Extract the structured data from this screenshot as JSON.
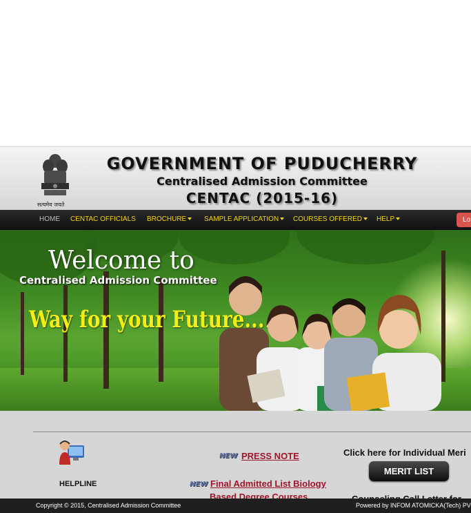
{
  "header": {
    "emblem_caption": "सत्यमेव जयते",
    "title_line1": "GOVERNMENT OF PUDUCHERRY",
    "title_line2": "Centralised Admission Committee",
    "title_line3": "CENTAC (2015-16)"
  },
  "nav": {
    "items": [
      {
        "label": "HOME"
      },
      {
        "label": "CENTAC OFFICIALS"
      },
      {
        "label": "BROCHURE"
      },
      {
        "label": "SAMPLE APPLICATION"
      },
      {
        "label": "COURSES OFFERED"
      },
      {
        "label": "HELP"
      }
    ],
    "login_label": "Lo"
  },
  "banner": {
    "welcome": "Welcome to",
    "subtitle": "Centralised Admission Committee",
    "tagline": "Way for your Future...."
  },
  "content": {
    "helpline_label": "HELPLINE",
    "new_badge": "NEW",
    "news": [
      {
        "label": "PRESS NOTE"
      },
      {
        "label": "Final Admitted List Biology"
      },
      {
        "label": "Based Degree Courses"
      }
    ],
    "merit_heading": "Click here for Individual Meri",
    "merit_button": "MERIT LIST",
    "counselling_text": "Counseling Call Letter for"
  },
  "footer": {
    "copyright": "Copyright © 2015, Centralised Admission Committee",
    "powered_by": "Powered by INFOM ATOMICKA(Tech) PV"
  },
  "colors": {
    "nav_text": "#f3d417",
    "news_link": "#a0142a",
    "tagline": "#f2ee16",
    "login_button": "#d9534f"
  }
}
